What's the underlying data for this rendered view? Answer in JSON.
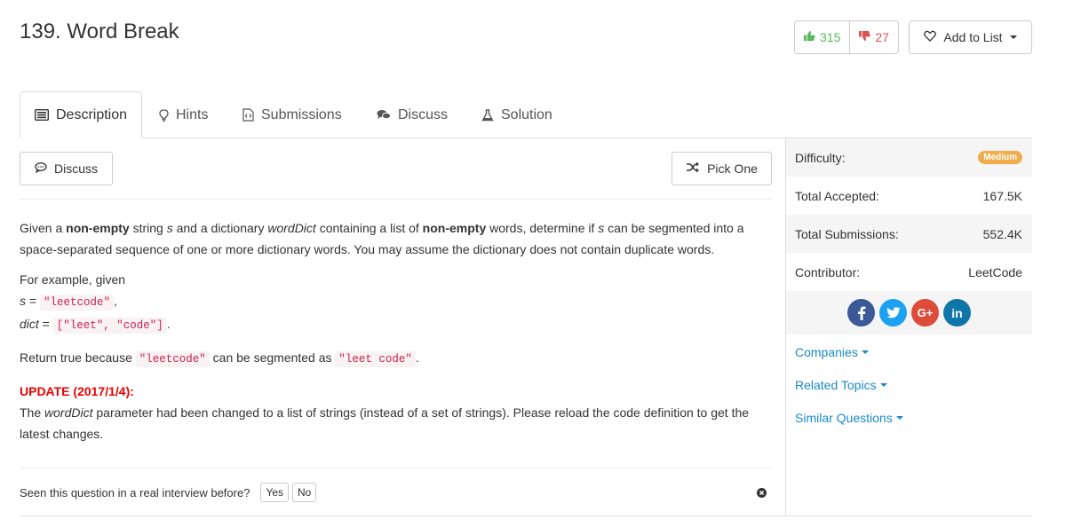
{
  "problem": {
    "title": "139. Word Break"
  },
  "votes": {
    "up": "315",
    "down": "27"
  },
  "add_to_list": "Add to List",
  "tabs": [
    {
      "label": "Description",
      "icon": "description-icon"
    },
    {
      "label": "Hints",
      "icon": "lightbulb-icon"
    },
    {
      "label": "Submissions",
      "icon": "code-file-icon"
    },
    {
      "label": "Discuss",
      "icon": "comments-icon"
    },
    {
      "label": "Solution",
      "icon": "flask-icon"
    }
  ],
  "actions": {
    "discuss": "Discuss",
    "pick_one": "Pick One"
  },
  "description": {
    "p1_a": "Given a ",
    "p1_b": "non-empty",
    "p1_c": " string ",
    "p1_d": "s",
    "p1_e": " and a dictionary ",
    "p1_f": "wordDict",
    "p1_g": " containing a list of ",
    "p1_h": "non-empty",
    "p1_i": " words, determine if ",
    "p1_j": "s",
    "p1_k": " can be segmented into a space-separated sequence of one or more dictionary words. You may assume the dictionary does not contain duplicate words.",
    "example_intro": "For example, given",
    "s_label": "s",
    "s_value": "\"leetcode\"",
    "dict_label": "dict",
    "dict_value": "[\"leet\", \"code\"]",
    "ret_a": "Return true because ",
    "ret_code1": "\"leetcode\"",
    "ret_b": " can be segmented as ",
    "ret_code2": "\"leet code\"",
    "update_title": "UPDATE (2017/1/4):",
    "update_a": "The ",
    "update_b": "wordDict",
    "update_c": " parameter had been changed to a list of strings (instead of a set of strings). Please reload the code definition to get the latest changes."
  },
  "interview": {
    "question": "Seen this question in a real interview before?",
    "yes": "Yes",
    "no": "No"
  },
  "sidebar": {
    "difficulty_label": "Difficulty:",
    "difficulty_value": "Medium",
    "accepted_label": "Total Accepted:",
    "accepted_value": "167.5K",
    "submissions_label": "Total Submissions:",
    "submissions_value": "552.4K",
    "contributor_label": "Contributor:",
    "contributor_value": "LeetCode",
    "links": [
      "Companies",
      "Related Topics",
      "Similar Questions"
    ]
  },
  "colors": {
    "upvote": "#5cb85c",
    "downvote": "#d9534f",
    "medium": "#f0ad4e",
    "link": "#1a8ac6",
    "facebook": "#3b5998",
    "twitter": "#1da1f2",
    "googleplus": "#dd4b39",
    "linkedin": "#0e76a8"
  }
}
